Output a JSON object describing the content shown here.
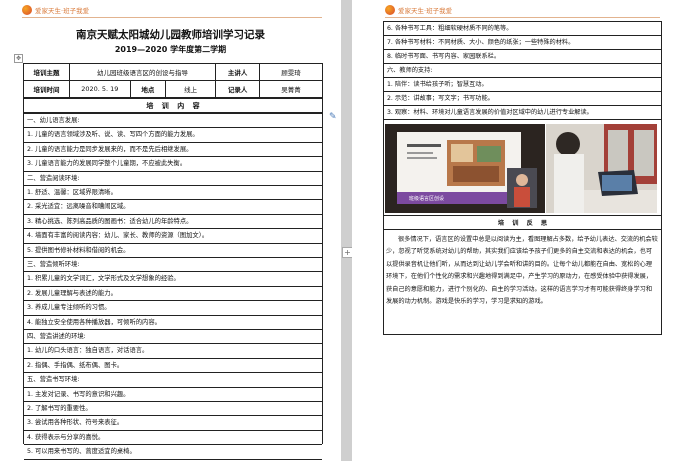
{
  "header": {
    "logo_text": "爱家天生·班子我爱"
  },
  "left": {
    "title": "南京天赋太阳城幼儿园教师培训学习记录",
    "subtitle": "2019—2020 学年度第二学期",
    "info": {
      "topic_label": "培训主题",
      "topic_value": "幼儿园班级语言区的创设与指导",
      "host_label": "主讲人",
      "host_value": "顾雯琦",
      "time_label": "培训时间",
      "time_value": "2020. 5. 19",
      "place_label": "地点",
      "place_value": "线上",
      "recorder_label": "记录人",
      "recorder_value": "吴菁菁"
    },
    "content_heading": "培 训 内 容",
    "lines": [
      "一、幼儿语言发展:",
      "1. 儿童的语言领域涉及听、说、读、写四个方面的能力发展。",
      "2. 儿童的语言能力是同步发展来的，而不是先后相继发展。",
      "3. 儿童语言能力的发展同学整个儿童期，不应被此失衡。",
      "二、营造阅读环境:",
      "1. 舒适、温馨：区域界限清晰。",
      "2. 采光适宜：远离噪音和嘈闹区域。",
      "3. 精心挑选、陈列高品质的图画书：适合幼儿的年龄特点。",
      "4. 墙面有丰富的阅读内容：幼儿、家长、教师的资源（图加文）。",
      "5. 提供图书修补材料和借阅的机会。",
      "三、营造倾听环境:",
      "1. 积累儿童的文学词汇，文学形式及文学想象的经验。",
      "2. 发展儿童理解与表述的能力。",
      "3. 养成儿童专注倾听的习惯。",
      "4. 能独立安全使用各种播放器，可倾听的内容。",
      "四、营造讲述的环境:",
      "1. 幼儿的口头语言：独自语言，对话语言。",
      "2. 指偶、手指偶、纸布偶、图卡。",
      "五、营造书写环境:",
      "1. 主发对记录、书写的意识和兴趣。",
      "2. 了解书写的重要性。",
      "3. 尝试用各种形状、符号来表征。",
      "4. 获得表示与分享的喜悦。",
      "5. 可以用来书写的、蒿度适宜的桌椅。"
    ]
  },
  "right": {
    "lines": [
      "6. 各种书写工具：粗细软硬材质不同的笔等。",
      "7. 各种书写材料：不同材质、大小、颜色的纸张；一些特殊的材料。",
      "8. 临时书写面、书写内容、家园联系栏。",
      "六、教师的支持:",
      "1. 陪伴：读书给孩子听；智慧互动。",
      "2. 示范：讲故事；写文字；书写功能。",
      "3. 观察：材料、环境对儿童语言发展的价值对区域中的幼儿进行专业解读。"
    ],
    "reflection_heading": "培 训 反 思",
    "reflection_text": "很多情况下，语言区的设置中总是以阅读为主，看图理解占多数，给予幼儿表达、交流的机会较少，忽视了听觉系统对幼儿的帮助，其实我们应该给予孩子们更多的自主交流和表达的机会，也可以提供录音机让他们听，从而达到让幼儿学会听和讲的目的。让每个幼儿都能在自由、宽松的心理环境下，在他们个性化的需求和兴趣地得到满足中，产生学习的原动力，在感受体验中获得发展，获自己的意愿和能力，进行个别化的、自主的学习活动。这样的语言学习才有可能获得终身学习和发展的动力机制。游戏是快乐的学习，学习是求知的游戏。",
    "photo_slide_caption": "班级语言区创设"
  },
  "colors": {
    "logo": "#d97a3a",
    "rule": "#e2b38f",
    "page_bg": "#ffffff",
    "gutter": "#d4d4d4"
  }
}
